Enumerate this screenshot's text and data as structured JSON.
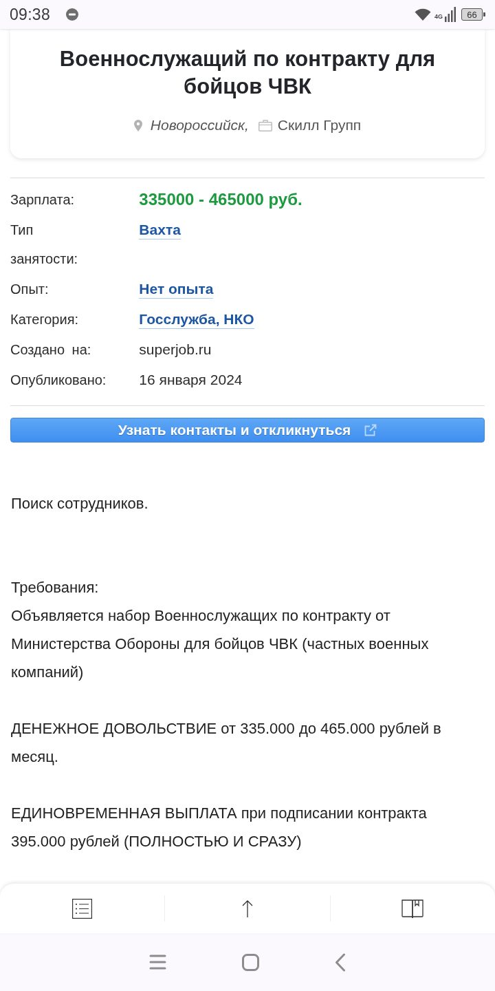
{
  "status_bar": {
    "time": "09:38",
    "network": "4G",
    "battery": "66"
  },
  "vacancy": {
    "title": "Военнослужащий по контракту для бойцов ЧВК",
    "location": "Новороссийск,",
    "company": "Скилл Групп"
  },
  "details": [
    {
      "label": "Зарплата:",
      "value": "335000 - 465000 руб.",
      "kind": "salary"
    },
    {
      "label": "Тип занятости:",
      "value": "Вахта",
      "kind": "link"
    },
    {
      "label": "Опыт:",
      "value": "Нет опыта",
      "kind": "link"
    },
    {
      "label": "Категория:",
      "value": "Госслужба, НКО",
      "kind": "link"
    },
    {
      "label": "Создано на:",
      "value": "superjob.ru",
      "kind": "text"
    },
    {
      "label": "Опубликовано:",
      "value": "16 января 2024",
      "kind": "text"
    }
  ],
  "apply_button": {
    "label": "Узнать контакты и откликнуться"
  },
  "description": {
    "summary": "Поиск сотрудников.",
    "blocks": [
      [
        "Требования:",
        "Объявляется набор Военнослужащих по контракту от Министерства Обороны для бойцов ЧВК (частных военных компаний)"
      ],
      [
        "ДЕНЕЖНОЕ ДОВОЛЬСТВИЕ от 335.000 до 465.000 рублей в месяц."
      ],
      [
        "ЕДИНОВРЕМЕННАЯ ВЫПЛАТА при подписании контракта 395.000 рублей (ПОЛНОСТЬЮ И СРАЗУ)"
      ]
    ]
  }
}
